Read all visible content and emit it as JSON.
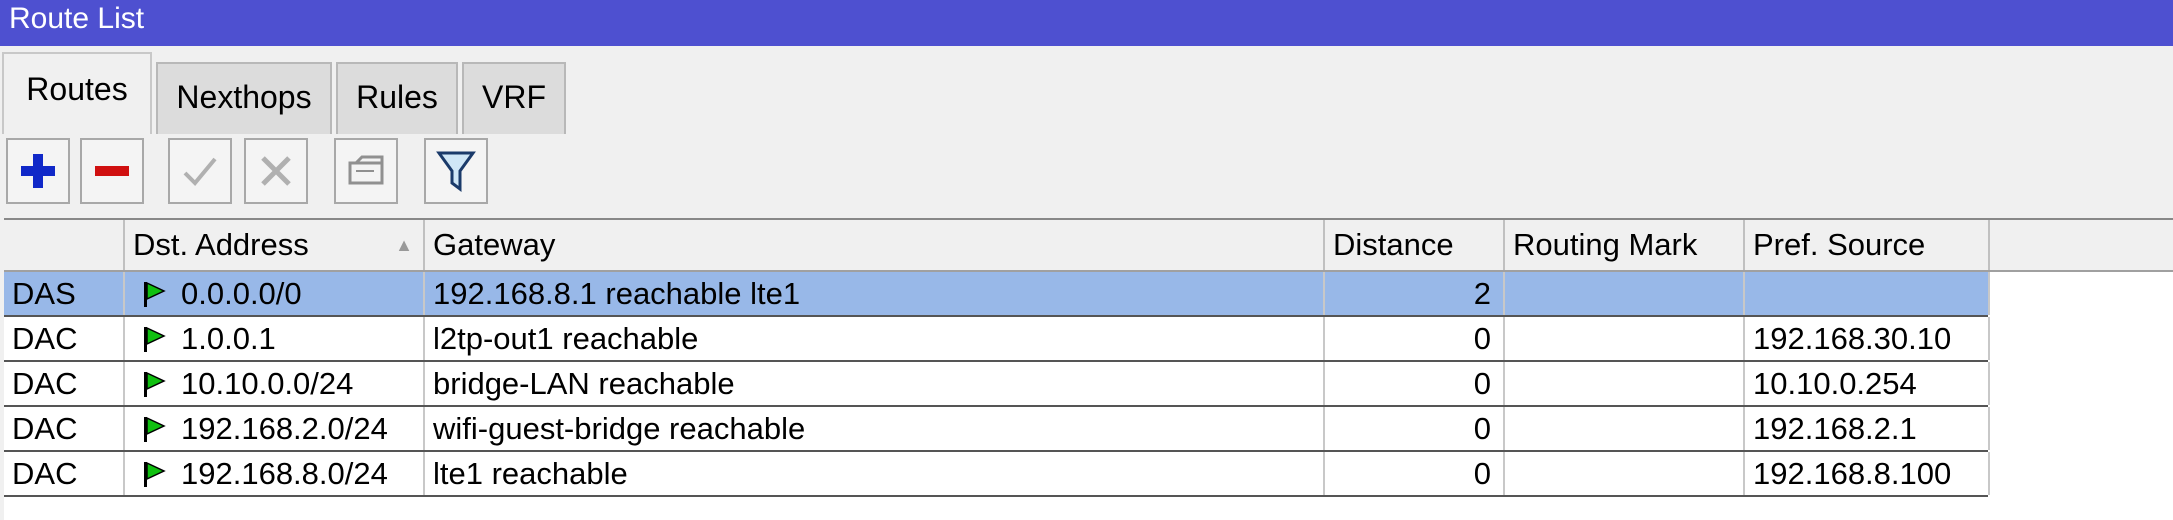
{
  "window": {
    "title": "Route List"
  },
  "tabs": [
    {
      "label": "Routes",
      "active": true
    },
    {
      "label": "Nexthops",
      "active": false
    },
    {
      "label": "Rules",
      "active": false
    },
    {
      "label": "VRF",
      "active": false
    }
  ],
  "toolbar": {
    "buttons": [
      {
        "name": "add-button",
        "icon": "plus-icon",
        "color": "#1028c8"
      },
      {
        "name": "remove-button",
        "icon": "minus-icon",
        "color": "#d01010"
      },
      {
        "name": "enable-button",
        "icon": "check-icon",
        "enabled": false
      },
      {
        "name": "disable-button",
        "icon": "cross-icon",
        "enabled": false
      },
      {
        "name": "comment-button",
        "icon": "comment-icon",
        "enabled": false
      },
      {
        "name": "filter-button",
        "icon": "filter-icon"
      }
    ]
  },
  "table": {
    "columns": [
      "",
      "Dst. Address",
      "Gateway",
      "Distance",
      "Routing Mark",
      "Pref. Source"
    ],
    "rows": [
      {
        "flags": "DAS",
        "dst": "0.0.0.0/0",
        "gateway": "192.168.8.1 reachable lte1",
        "distance": "2",
        "routing_mark": "",
        "pref_source": "",
        "selected": true
      },
      {
        "flags": "DAC",
        "dst": "1.0.0.1",
        "gateway": "l2tp-out1 reachable",
        "distance": "0",
        "routing_mark": "",
        "pref_source": "192.168.30.10",
        "selected": false
      },
      {
        "flags": "DAC",
        "dst": "10.10.0.0/24",
        "gateway": "bridge-LAN reachable",
        "distance": "0",
        "routing_mark": "",
        "pref_source": "10.10.0.254",
        "selected": false
      },
      {
        "flags": "DAC",
        "dst": "192.168.2.0/24",
        "gateway": "wifi-guest-bridge reachable",
        "distance": "0",
        "routing_mark": "",
        "pref_source": "192.168.2.1",
        "selected": false
      },
      {
        "flags": "DAC",
        "dst": "192.168.8.0/24",
        "gateway": "lte1 reachable",
        "distance": "0",
        "routing_mark": "",
        "pref_source": "192.168.8.100",
        "selected": false
      }
    ]
  },
  "colors": {
    "titlebar": "#4e50d0",
    "selected_row": "#98b8e8",
    "flag_green": "#10c010"
  }
}
